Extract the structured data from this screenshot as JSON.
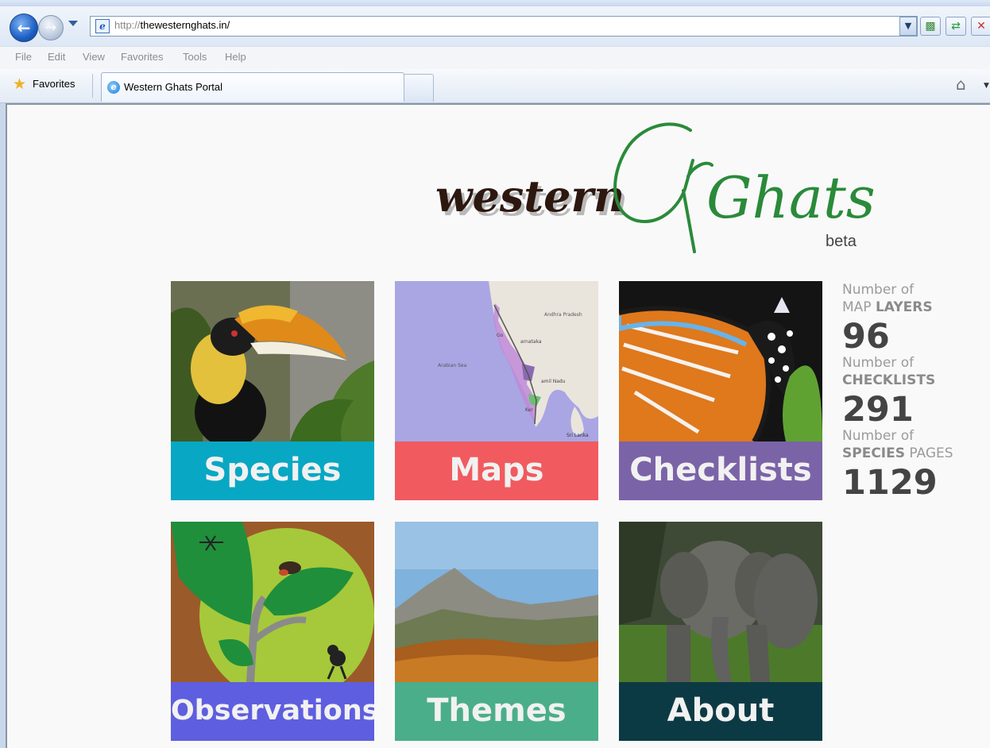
{
  "browser": {
    "url_prefix": "http://",
    "url_host": "thewesternghats.in/",
    "menu": [
      "File",
      "Edit",
      "View",
      "Favorites",
      "Tools",
      "Help"
    ],
    "favorites_label": "Favorites",
    "tab_title": "Western Ghats Portal"
  },
  "logo": {
    "word1": "western",
    "word2": "Ghats",
    "tag": "beta"
  },
  "tiles": [
    {
      "label": "Species",
      "color": "#08a7c4"
    },
    {
      "label": "Maps",
      "color": "#f15a5f"
    },
    {
      "label": "Checklists",
      "color": "#7b63a8"
    },
    {
      "label": "Observations",
      "color": "#5e5ee0"
    },
    {
      "label": "Themes",
      "color": "#4aae8a"
    },
    {
      "label": "About",
      "color": "#0c3a44"
    }
  ],
  "map_labels": {
    "andhra": "Andhra Pradesh",
    "arabian": "Arabian Sea",
    "karnataka": "arnataka",
    "tamil": "amil Nadu",
    "goa": "Go",
    "kerala": "Ker",
    "srilanka": "Sri Lanka"
  },
  "stats": [
    {
      "caption_light": "Number of",
      "caption_pre": "MAP ",
      "caption_bold": "LAYERS",
      "caption_post": "",
      "value": "96"
    },
    {
      "caption_light": "Number of",
      "caption_pre": "",
      "caption_bold": "CHECKLISTS",
      "caption_post": "",
      "value": "291"
    },
    {
      "caption_light": "Number of",
      "caption_pre": "",
      "caption_bold": "SPECIES",
      "caption_post": " PAGES",
      "value": "1129"
    }
  ]
}
